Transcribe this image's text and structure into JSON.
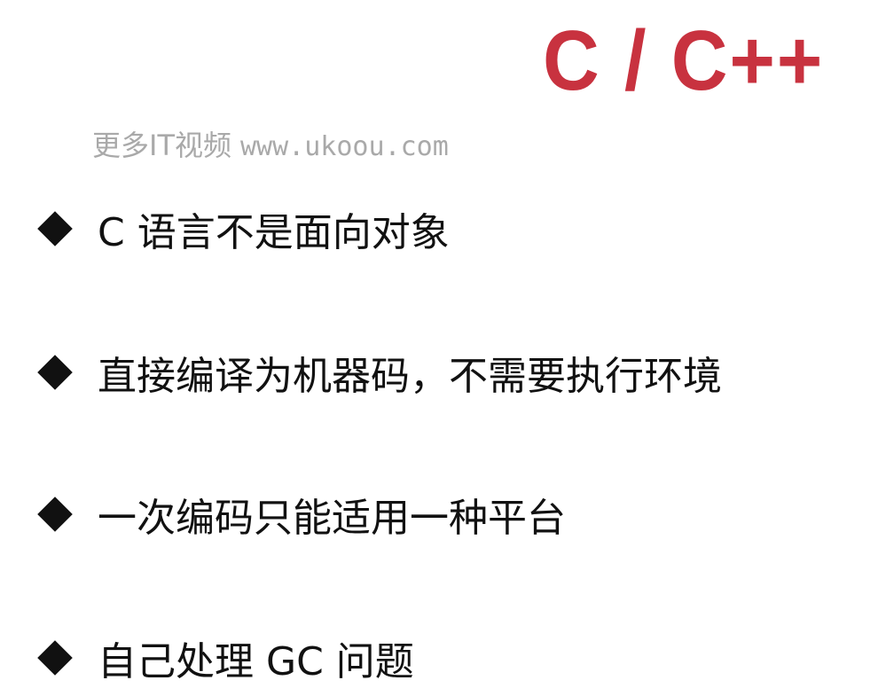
{
  "title": "C / C++",
  "watermark": {
    "text": "更多IT视频",
    "url": "www.ukoou.com"
  },
  "bullets": [
    "C 语言不是面向对象",
    "直接编译为机器码，不需要执行环境",
    "一次编码只能适用一种平台",
    "自己处理 GC 问题"
  ],
  "colors": {
    "title": "#c8323f",
    "text": "#111111",
    "watermark": "#a9a9a9"
  }
}
